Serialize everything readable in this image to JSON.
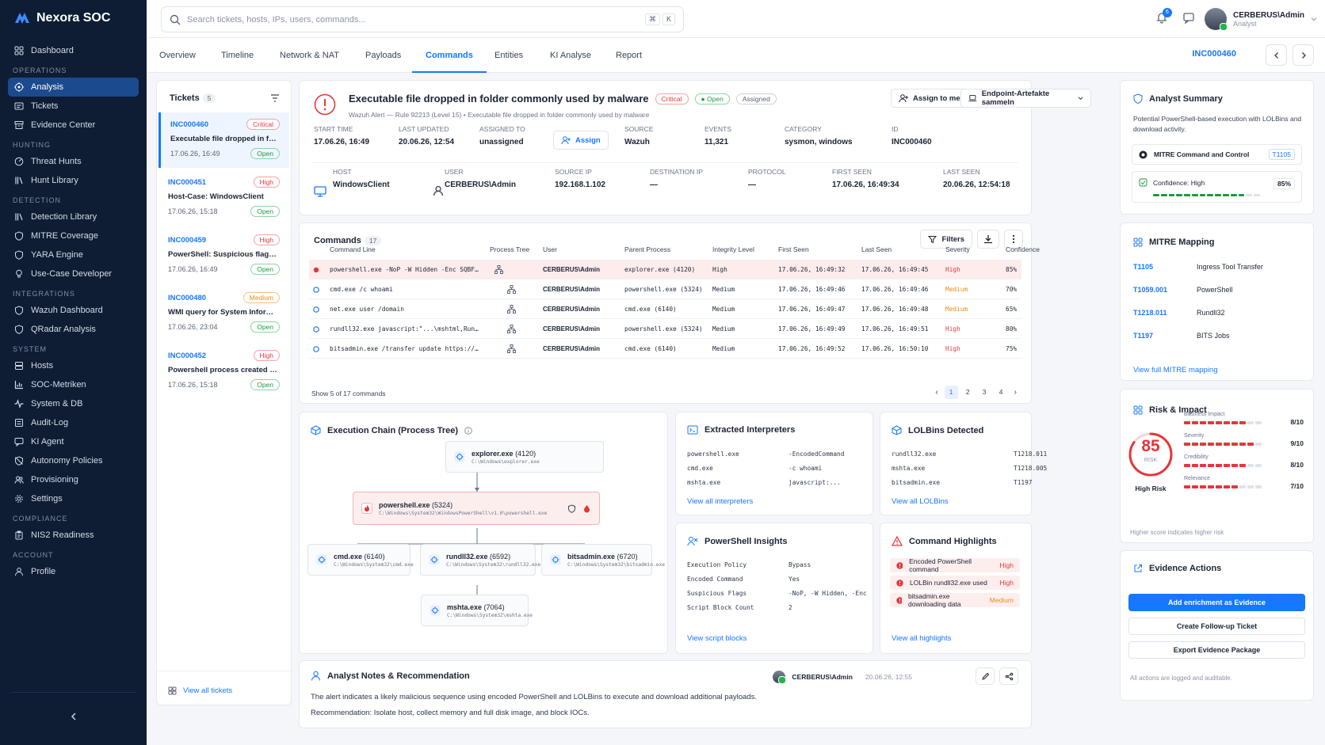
{
  "brand": "Nexora SOC",
  "sidebar": {
    "sections": [
      {
        "title": "",
        "items": [
          {
            "label": "Dashboard",
            "icon": "grid-icon"
          }
        ]
      },
      {
        "title": "OPERATIONS",
        "items": [
          {
            "label": "Analysis",
            "icon": "target-icon",
            "active": true
          },
          {
            "label": "Tickets",
            "icon": "ticket-icon"
          },
          {
            "label": "Evidence Center",
            "icon": "archive-icon"
          }
        ]
      },
      {
        "title": "HUNTING",
        "items": [
          {
            "label": "Threat Hunts",
            "icon": "radar-icon"
          },
          {
            "label": "Hunt Library",
            "icon": "library-icon"
          }
        ]
      },
      {
        "title": "DETECTION",
        "items": [
          {
            "label": "Detection Library",
            "icon": "library-icon"
          },
          {
            "label": "MITRE Coverage",
            "icon": "shield-icon"
          },
          {
            "label": "YARA Engine",
            "icon": "shield-icon"
          },
          {
            "label": "Use-Case Developer",
            "icon": "bulb-icon"
          }
        ]
      },
      {
        "title": "INTEGRATIONS",
        "items": [
          {
            "label": "Wazuh Dashboard",
            "icon": "shield-icon"
          },
          {
            "label": "QRadar Analysis",
            "icon": "shield-icon"
          }
        ]
      },
      {
        "title": "SYSTEM",
        "items": [
          {
            "label": "Hosts",
            "icon": "server-icon"
          },
          {
            "label": "SOC-Metriken",
            "icon": "chart-icon"
          },
          {
            "label": "System & DB",
            "icon": "pulse-icon"
          },
          {
            "label": "Audit-Log",
            "icon": "list-icon"
          },
          {
            "label": "KI Agent",
            "icon": "chat-icon"
          },
          {
            "label": "Autonomy Policies",
            "icon": "shield-off-icon"
          },
          {
            "label": "Provisioning",
            "icon": "people-icon"
          },
          {
            "label": "Settings",
            "icon": "gear-icon"
          }
        ]
      },
      {
        "title": "COMPLIANCE",
        "items": [
          {
            "label": "NIS2 Readiness",
            "icon": "clipboard-icon"
          }
        ]
      },
      {
        "title": "ACCOUNT",
        "items": [
          {
            "label": "Profile",
            "icon": "user-icon"
          }
        ]
      }
    ]
  },
  "header": {
    "search_placeholder": "Search tickets, hosts, IPs, users, commands...",
    "kbd1": "⌘",
    "kbd2": "K",
    "notif_count": "6",
    "user_name": "CERBERUS\\Admin",
    "user_role": "Analyst"
  },
  "tabs": [
    "Overview",
    "Timeline",
    "Network & NAT",
    "Payloads",
    "Commands",
    "Entities",
    "KI Analyse",
    "Report"
  ],
  "active_tab": "Commands",
  "incident_id": "INC000460",
  "tickets": {
    "title": "Tickets",
    "count": "5",
    "view_all": "View all tickets",
    "items": [
      {
        "id": "INC000460",
        "severity": "Critical",
        "title": "Executable file dropped in fol...",
        "date": "17.06.26, 16:49",
        "status": "Open"
      },
      {
        "id": "INC000451",
        "severity": "High",
        "title": "Host-Case: WindowsClient",
        "date": "17.06.26, 15:18",
        "status": "Open"
      },
      {
        "id": "INC000459",
        "severity": "High",
        "title": "PowerShell: Suspicious flags - ...",
        "date": "17.06.26, 16:49",
        "status": "Open"
      },
      {
        "id": "INC000480",
        "severity": "Medium",
        "title": "WMI query for System Informa...",
        "date": "17.06.26, 23:04",
        "status": "Open"
      },
      {
        "id": "INC000452",
        "severity": "High",
        "title": "Powershell process created an ...",
        "date": "17.06.26, 15:18",
        "status": "Open"
      }
    ]
  },
  "alert": {
    "title": "Executable file dropped in folder commonly used by malware",
    "severity": "Critical",
    "status": "Open",
    "assignment": "Assigned",
    "subtitle": "Wazuh Alert — Rule 92213 (Level 15) • Executable file dropped in folder commonly used by malware",
    "assign_me": "Assign to me",
    "collect": "Endpoint-Artefakte sammeln",
    "assign": "Assign",
    "fields1": [
      {
        "label": "START TIME",
        "value": "17.06.26, 16:49"
      },
      {
        "label": "LAST UPDATED",
        "value": "20.06.26, 12:54"
      },
      {
        "label": "ASSIGNED TO",
        "value": "unassigned"
      },
      {
        "label": "SOURCE",
        "value": "Wazuh"
      },
      {
        "label": "EVENTS",
        "value": "11,321"
      },
      {
        "label": "CATEGORY",
        "value": "sysmon, windows"
      },
      {
        "label": "ID",
        "value": "INC000460"
      }
    ],
    "fields2": [
      {
        "label": "HOST",
        "value": "WindowsClient"
      },
      {
        "label": "USER",
        "value": "CERBERUS\\Admin"
      },
      {
        "label": "SOURCE IP",
        "value": "192.168.1.102"
      },
      {
        "label": "DESTINATION IP",
        "value": "—"
      },
      {
        "label": "PROTOCOL",
        "value": "—"
      },
      {
        "label": "FIRST SEEN",
        "value": "17.06.26, 16:49:34"
      },
      {
        "label": "LAST SEEN",
        "value": "20.06.26, 12:54:18"
      }
    ]
  },
  "commands": {
    "title": "Commands",
    "count": "17",
    "filters": "Filters",
    "columns": [
      "Command Line",
      "Process Tree",
      "User",
      "Parent Process",
      "Integrity Level",
      "First Seen",
      "Last Seen",
      "Severity",
      "Confidence"
    ],
    "rows": [
      {
        "cmd": "powershell.exe -NoP -W Hidden -Enc SQBFAFgA...",
        "user": "CERBERUS\\Admin",
        "parent": "explorer.exe (4120)",
        "integrity": "High",
        "first": "17.06.26, 16:49:32",
        "last": "17.06.26, 16:49:45",
        "severity": "High",
        "confidence": "85%"
      },
      {
        "cmd": "cmd.exe /c whoami",
        "user": "CERBERUS\\Admin",
        "parent": "powershell.exe (5324)",
        "integrity": "Medium",
        "first": "17.06.26, 16:49:46",
        "last": "17.06.26, 16:49:46",
        "severity": "Medium",
        "confidence": "70%"
      },
      {
        "cmd": "net.exe user /domain",
        "user": "CERBERUS\\Admin",
        "parent": "cmd.exe (6140)",
        "integrity": "Medium",
        "first": "17.06.26, 16:49:47",
        "last": "17.06.26, 16:49:48",
        "severity": "Medium",
        "confidence": "65%"
      },
      {
        "cmd": "rundll32.exe javascript:\"...\\mshtml,RunHTML...",
        "user": "CERBERUS\\Admin",
        "parent": "powershell.exe (5324)",
        "integrity": "Medium",
        "first": "17.06.26, 16:49:49",
        "last": "17.06.26, 16:49:51",
        "severity": "High",
        "confidence": "80%"
      },
      {
        "cmd": "bitsadmin.exe /transfer update https://malici...",
        "user": "CERBERUS\\Admin",
        "parent": "cmd.exe (6140)",
        "integrity": "Medium",
        "first": "17.06.26, 16:49:52",
        "last": "17.06.26, 16:50:10",
        "severity": "High",
        "confidence": "75%"
      }
    ],
    "showing": "Show 5 of 17 commands",
    "pages": [
      "1",
      "2",
      "3",
      "4"
    ]
  },
  "chain": {
    "title": "Execution Chain (Process Tree)",
    "nodes": [
      {
        "name": "explorer.exe",
        "pid": "(4120)",
        "path": "C:\\Windows\\explorer.exe"
      },
      {
        "name": "powershell.exe",
        "pid": "(5324)",
        "path": "C:\\Windows\\System32\\WindowsPowerShell\\v1.0\\powershell.exe"
      },
      {
        "name": "cmd.exe",
        "pid": "(6140)",
        "path": "C:\\Windows\\System32\\cmd.exe"
      },
      {
        "name": "rundll32.exe",
        "pid": "(6592)",
        "path": "C:\\Windows\\System32\\rundll32.exe"
      },
      {
        "name": "bitsadmin.exe",
        "pid": "(6720)",
        "path": "C:\\Windows\\System32\\bitsadmin.exe"
      },
      {
        "name": "mshta.exe",
        "pid": "(7064)",
        "path": "C:\\Windows\\System32\\mshta.exe"
      }
    ]
  },
  "interpreters": {
    "title": "Extracted Interpreters",
    "rows": [
      [
        "powershell.exe",
        "-EncodedCommand"
      ],
      [
        "cmd.exe",
        "-c whoami"
      ],
      [
        "mshta.exe",
        "javascript:..."
      ]
    ],
    "link": "View all interpreters"
  },
  "lolbins": {
    "title": "LOLBins Detected",
    "rows": [
      [
        "rundll32.exe",
        "T1218.011"
      ],
      [
        "mshta.exe",
        "T1218.005"
      ],
      [
        "bitsadmin.exe",
        "T1197"
      ]
    ],
    "link": "View all LOLBins"
  },
  "ps_insights": {
    "title": "PowerShell Insights",
    "rows": [
      [
        "Execution Policy",
        "Bypass"
      ],
      [
        "Encoded Command",
        "Yes"
      ],
      [
        "Suspicious Flags",
        "-NoP, -W Hidden, -Enc"
      ],
      [
        "Script Block Count",
        "2"
      ]
    ],
    "link": "View script blocks"
  },
  "highlights": {
    "title": "Command Highlights",
    "rows": [
      {
        "text": "Encoded PowerShell command",
        "severity": "High"
      },
      {
        "text": "LOLBin rundll32.exe used",
        "severity": "High"
      },
      {
        "text": "bitsadmin.exe downloading data",
        "severity": "Medium"
      }
    ],
    "link": "View all highlights"
  },
  "notes": {
    "title": "Analyst Notes & Recommendation",
    "author": "CERBERUS\\Admin",
    "date": "20.06.26, 12:55",
    "line1": "The alert indicates a likely malicious sequence using encoded PowerShell and LOLBins to execute and download additional payloads.",
    "line2": "Recommendation: Isolate host, collect memory and full disk image, and block IOCs."
  },
  "summary": {
    "title": "Analyst Summary",
    "text": "Potential PowerShell-based execution with LOLBins and download activity.",
    "tactic": "MITRE Command and Control",
    "tactic_id": "T1105",
    "confidence_label": "Confidence: High",
    "confidence_value": "85%",
    "confidence_fraction": 0.85
  },
  "mitre": {
    "title": "MITRE Mapping",
    "rows": [
      [
        "T1105",
        "Ingress Tool Transfer"
      ],
      [
        "T1059.001",
        "PowerShell"
      ],
      [
        "T1218.011",
        "Rundll32"
      ],
      [
        "T1197",
        "BITS Jobs"
      ]
    ],
    "link": "View full MITRE mapping"
  },
  "risk": {
    "title": "Risk & Impact",
    "score": "85",
    "score_label": "RISK",
    "level": "High Risk",
    "score_fraction": 0.85,
    "metrics": [
      {
        "label": "Business Impact",
        "value": "8/10",
        "level": 8
      },
      {
        "label": "Severity",
        "value": "9/10",
        "level": 9
      },
      {
        "label": "Credibility",
        "value": "8/10",
        "level": 8
      },
      {
        "label": "Relevance",
        "value": "7/10",
        "level": 7
      }
    ],
    "footnote": "Higher score indicates higher risk"
  },
  "evidence": {
    "title": "Evidence Actions",
    "primary": "Add enrichment as Evidence",
    "followup": "Create Follow-up Ticket",
    "export": "Export Evidence Package",
    "footnote": "All actions are logged and auditable."
  },
  "colors": {
    "accent": "#1677ff",
    "sidebar": "#0e1d33",
    "danger": "#e5363a",
    "warning": "#e88d13",
    "success": "#1b9a3e"
  }
}
